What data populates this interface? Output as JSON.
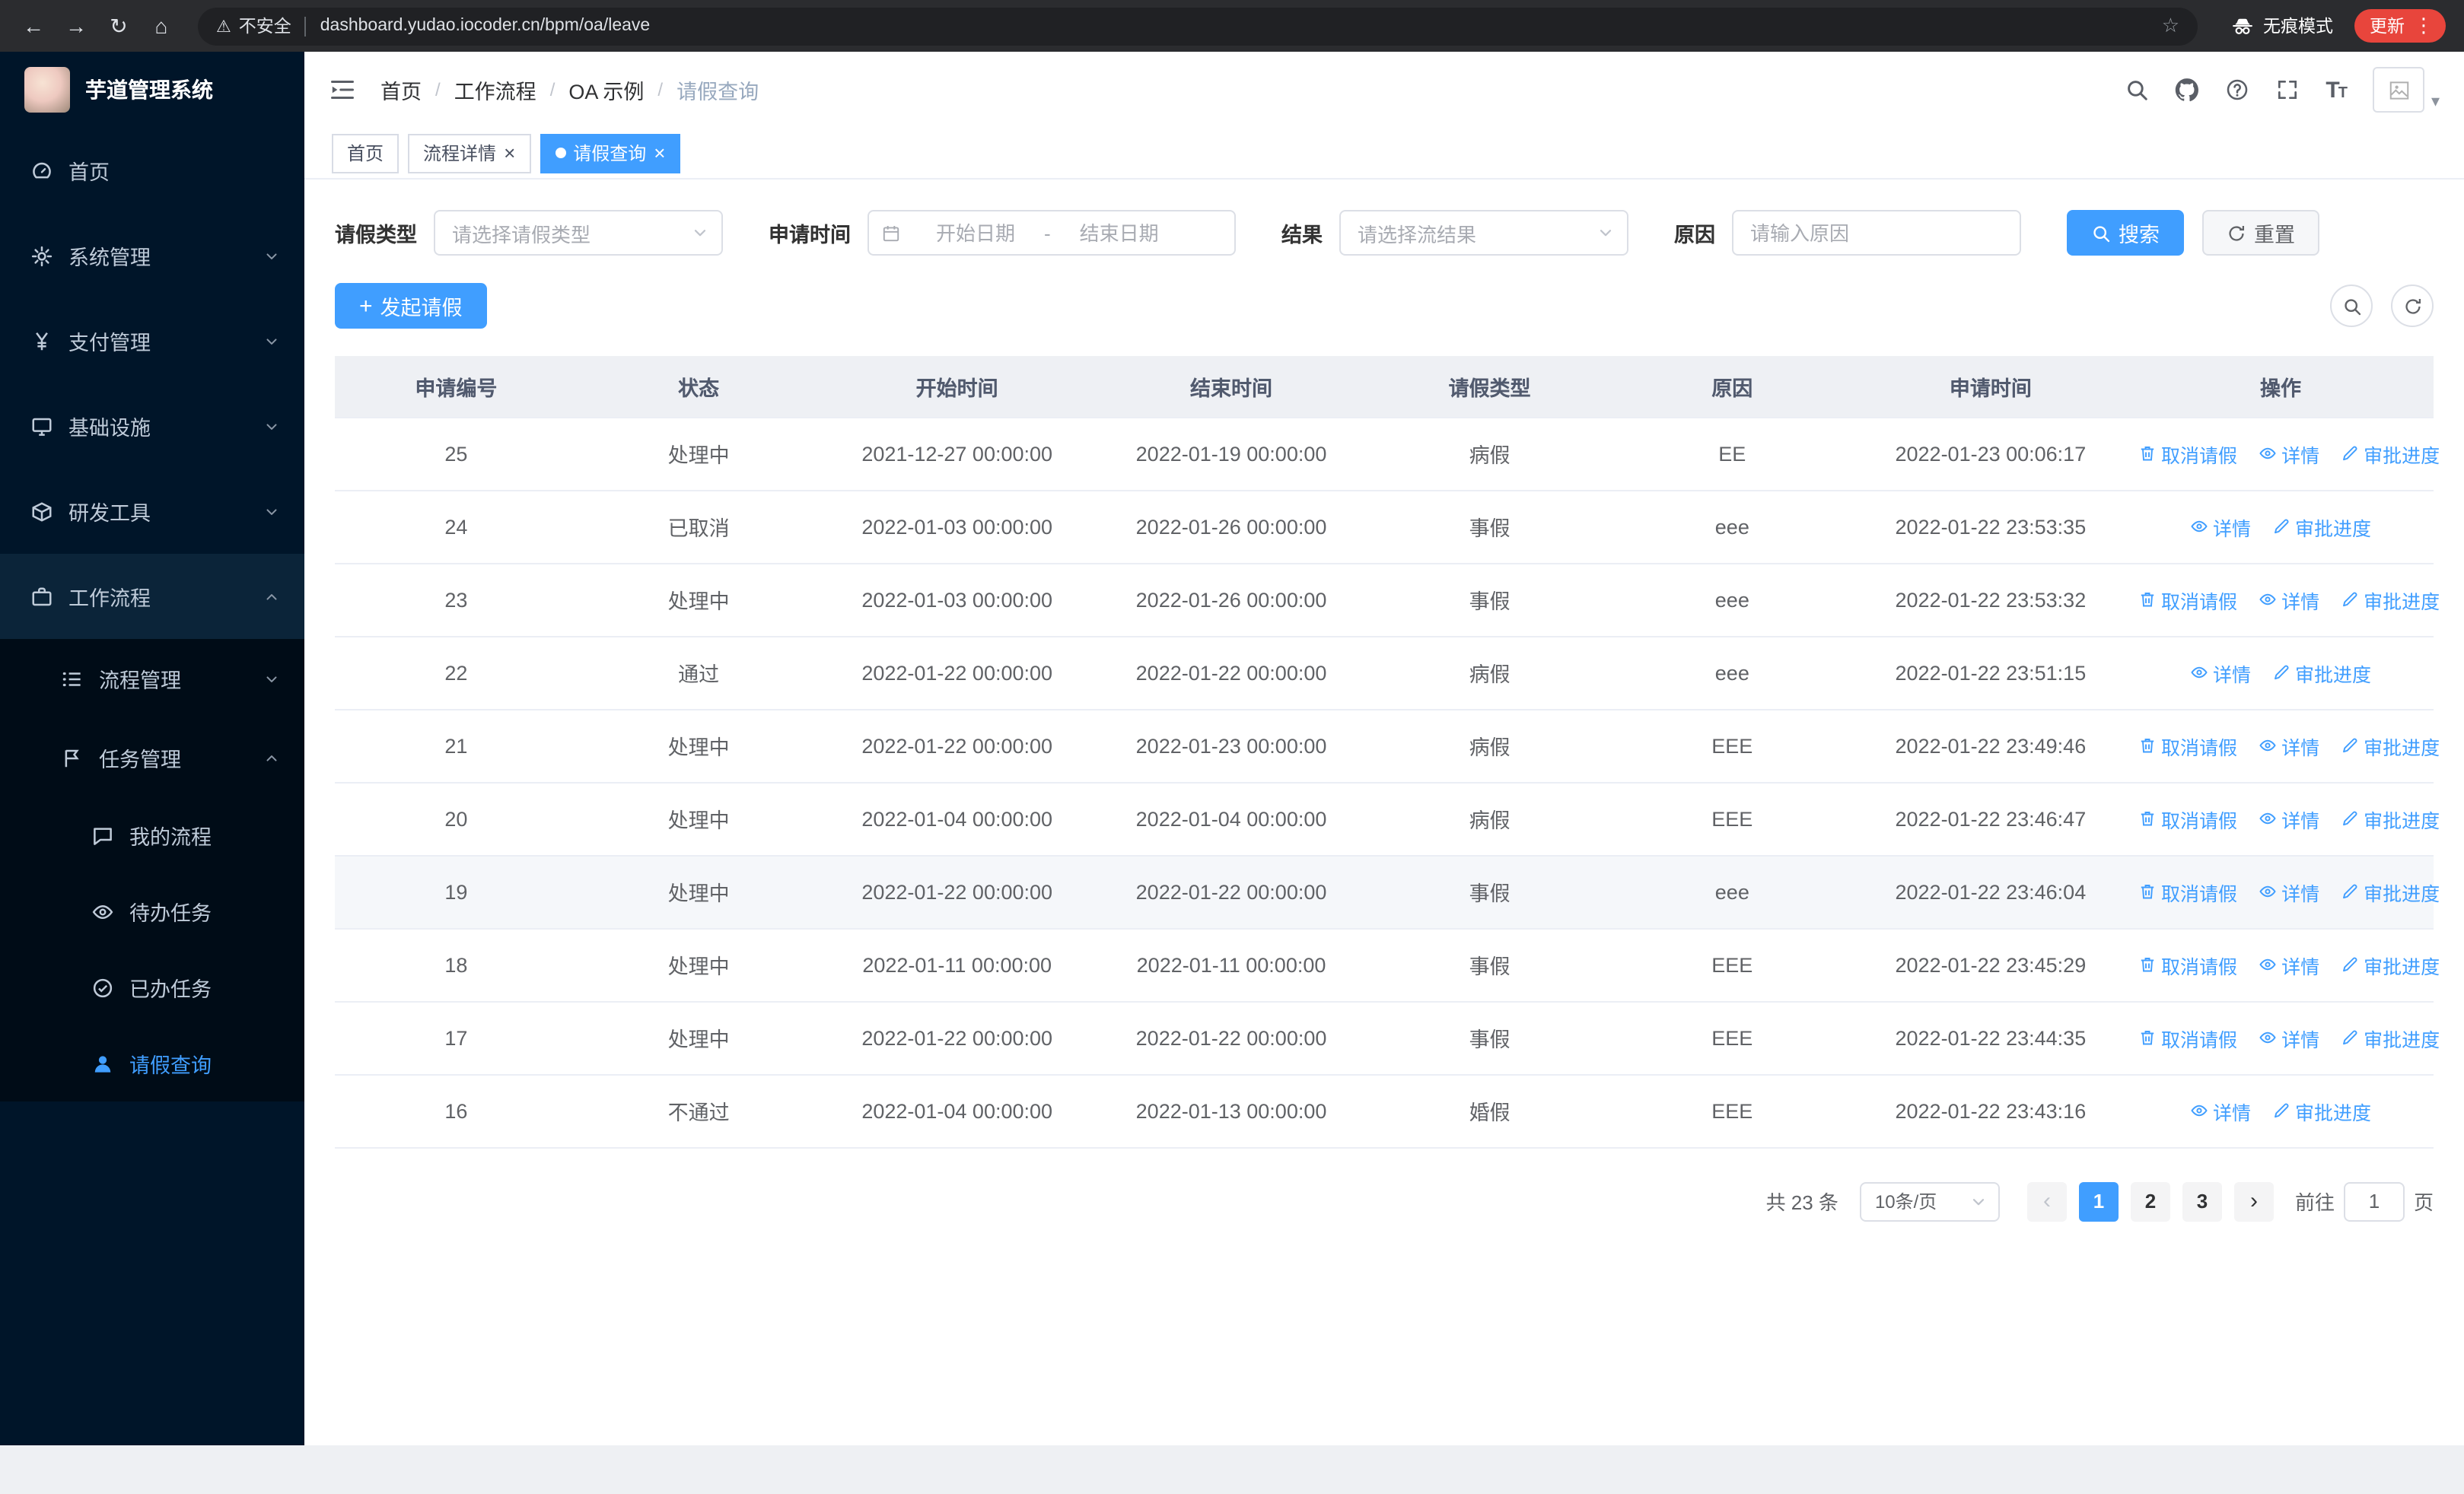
{
  "colors": {
    "primary": "#409eff",
    "sidebar_bg": "#001529",
    "submenu_bg": "#000c17",
    "header_bg": "#eef0f4",
    "update_badge": "#e8453c"
  },
  "browser": {
    "security_label": "不安全",
    "url": "dashboard.yudao.iocoder.cn/bpm/oa/leave",
    "incognito_label": "无痕模式",
    "update_label": "更新"
  },
  "sidebar": {
    "logo_title": "芋道管理系统",
    "items": [
      {
        "name": "home",
        "label": "首页",
        "icon": "dashboard-icon",
        "level": 1
      },
      {
        "name": "system",
        "label": "系统管理",
        "icon": "gear-icon",
        "level": 1,
        "arrow": "down"
      },
      {
        "name": "payment",
        "label": "支付管理",
        "icon": "yen-icon",
        "level": 1,
        "arrow": "down"
      },
      {
        "name": "infrastructure",
        "label": "基础设施",
        "icon": "monitor-icon",
        "level": 1,
        "arrow": "down"
      },
      {
        "name": "devtools",
        "label": "研发工具",
        "icon": "box-icon",
        "level": 1,
        "arrow": "down"
      },
      {
        "name": "workflow",
        "label": "工作流程",
        "icon": "briefcase-icon",
        "level": 1,
        "arrow": "up",
        "open": true
      },
      {
        "name": "process-management",
        "label": "流程管理",
        "icon": "list-icon",
        "level": 2,
        "arrow": "down"
      },
      {
        "name": "task-management",
        "label": "任务管理",
        "icon": "flag-icon",
        "level": 2,
        "arrow": "up",
        "open": true
      },
      {
        "name": "my-process",
        "label": "我的流程",
        "icon": "chat-icon",
        "level": 3
      },
      {
        "name": "todo-tasks",
        "label": "待办任务",
        "icon": "eye-icon",
        "level": 3
      },
      {
        "name": "done-tasks",
        "label": "已办任务",
        "icon": "check-icon",
        "level": 3
      },
      {
        "name": "leave-query",
        "label": "请假查询",
        "icon": "user-icon",
        "level": 3,
        "active": true
      }
    ]
  },
  "breadcrumb": [
    "首页",
    "工作流程",
    "OA 示例",
    "请假查询"
  ],
  "tabs": [
    {
      "name": "home",
      "label": "首页",
      "closable": false,
      "active": false
    },
    {
      "name": "process-detail",
      "label": "流程详情",
      "closable": true,
      "active": false
    },
    {
      "name": "leave-query",
      "label": "请假查询",
      "closable": true,
      "active": true
    }
  ],
  "filters": {
    "leave_type_label": "请假类型",
    "leave_type_placeholder": "请选择请假类型",
    "apply_time_label": "申请时间",
    "start_placeholder": "开始日期",
    "range_separator": "-",
    "end_placeholder": "结束日期",
    "result_label": "结果",
    "result_placeholder": "请选择流结果",
    "reason_label": "原因",
    "reason_placeholder": "请输入原因",
    "search_label": "搜索",
    "reset_label": "重置"
  },
  "toolbar": {
    "create_label": "发起请假"
  },
  "table": {
    "columns": [
      "申请编号",
      "状态",
      "开始时间",
      "结束时间",
      "请假类型",
      "原因",
      "申请时间",
      "操作"
    ],
    "action_labels": {
      "cancel": "取消请假",
      "detail": "详情",
      "progress": "审批进度"
    },
    "rows": [
      {
        "id": "25",
        "status": "处理中",
        "start": "2021-12-27 00:00:00",
        "end": "2022-01-19 00:00:00",
        "type": "病假",
        "reason": "EE",
        "apply_time": "2022-01-23 00:06:17",
        "actions": [
          "cancel",
          "detail",
          "progress"
        ]
      },
      {
        "id": "24",
        "status": "已取消",
        "start": "2022-01-03 00:00:00",
        "end": "2022-01-26 00:00:00",
        "type": "事假",
        "reason": "eee",
        "apply_time": "2022-01-22 23:53:35",
        "actions": [
          "detail",
          "progress"
        ]
      },
      {
        "id": "23",
        "status": "处理中",
        "start": "2022-01-03 00:00:00",
        "end": "2022-01-26 00:00:00",
        "type": "事假",
        "reason": "eee",
        "apply_time": "2022-01-22 23:53:32",
        "actions": [
          "cancel",
          "detail",
          "progress"
        ]
      },
      {
        "id": "22",
        "status": "通过",
        "start": "2022-01-22 00:00:00",
        "end": "2022-01-22 00:00:00",
        "type": "病假",
        "reason": "eee",
        "apply_time": "2022-01-22 23:51:15",
        "actions": [
          "detail",
          "progress"
        ]
      },
      {
        "id": "21",
        "status": "处理中",
        "start": "2022-01-22 00:00:00",
        "end": "2022-01-23 00:00:00",
        "type": "病假",
        "reason": "EEE",
        "apply_time": "2022-01-22 23:49:46",
        "actions": [
          "cancel",
          "detail",
          "progress"
        ]
      },
      {
        "id": "20",
        "status": "处理中",
        "start": "2022-01-04 00:00:00",
        "end": "2022-01-04 00:00:00",
        "type": "病假",
        "reason": "EEE",
        "apply_time": "2022-01-22 23:46:47",
        "actions": [
          "cancel",
          "detail",
          "progress"
        ]
      },
      {
        "id": "19",
        "status": "处理中",
        "start": "2022-01-22 00:00:00",
        "end": "2022-01-22 00:00:00",
        "type": "事假",
        "reason": "eee",
        "apply_time": "2022-01-22 23:46:04",
        "actions": [
          "cancel",
          "detail",
          "progress"
        ],
        "hover": true
      },
      {
        "id": "18",
        "status": "处理中",
        "start": "2022-01-11 00:00:00",
        "end": "2022-01-11 00:00:00",
        "type": "事假",
        "reason": "EEE",
        "apply_time": "2022-01-22 23:45:29",
        "actions": [
          "cancel",
          "detail",
          "progress"
        ]
      },
      {
        "id": "17",
        "status": "处理中",
        "start": "2022-01-22 00:00:00",
        "end": "2022-01-22 00:00:00",
        "type": "事假",
        "reason": "EEE",
        "apply_time": "2022-01-22 23:44:35",
        "actions": [
          "cancel",
          "detail",
          "progress"
        ]
      },
      {
        "id": "16",
        "status": "不通过",
        "start": "2022-01-04 00:00:00",
        "end": "2022-01-13 00:00:00",
        "type": "婚假",
        "reason": "EEE",
        "apply_time": "2022-01-22 23:43:16",
        "actions": [
          "detail",
          "progress"
        ]
      }
    ]
  },
  "pagination": {
    "total_text": "共 23 条",
    "page_size_value": "10条/页",
    "pages": [
      "1",
      "2",
      "3"
    ],
    "current_page": "1",
    "goto_label": "前往",
    "goto_value": "1",
    "goto_suffix": "页"
  }
}
